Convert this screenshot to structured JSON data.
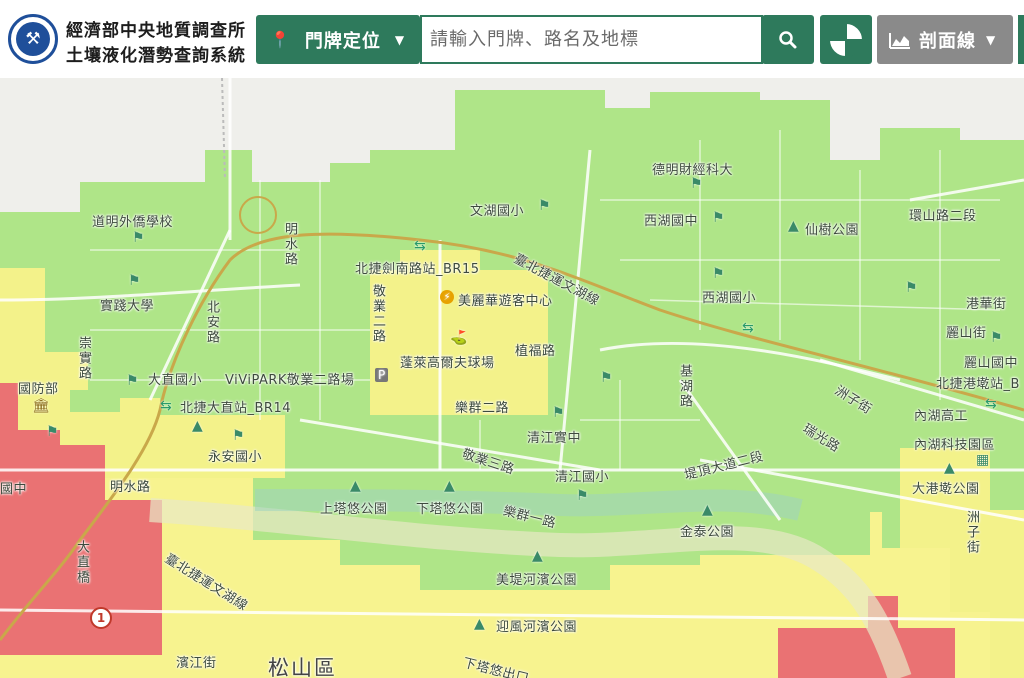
{
  "header": {
    "title_line1": "經濟部中央地質調查所",
    "title_line2": "土壤液化潛勢查詢系統",
    "logo_icon": "agency-seal-icon",
    "locate_label": "門牌定位",
    "search_placeholder": "請輸入門牌、路名及地標",
    "profile_label": "剖面線"
  },
  "colors": {
    "high": "#e96a72",
    "medium": "#f7f28a",
    "low": "#a9e47f",
    "accent": "#2e7a5c"
  },
  "map": {
    "district": "松山區",
    "labels": {
      "daoming": "道明外僑學校",
      "wenhu": "文湖國小",
      "deming": "德明財經科大",
      "xihu_jh": "西湖國中",
      "xianshu": "仙樹公園",
      "huanshan": "環山路二段",
      "shijian": "實踐大學",
      "mingshui_rd_top": "明水路",
      "beijie_jiannan": "北捷劍南路站_BR15",
      "meili": "美麗華遊客中心",
      "wenhu_line": "臺北捷運文湖線",
      "xihu_es": "西湖國小",
      "ganghua": "港華街",
      "beian": "北安路",
      "jingye2": "敬業二路",
      "lilai": "蓬萊高爾夫球場",
      "zhifu": "植福路",
      "lishan": "麗山街",
      "lishan_jh": "麗山國中",
      "beijie_gangshu": "北捷港墘站_B",
      "chongshi": "崇實路",
      "dazhi_es": "大直國小",
      "vivipark": "ViViPARK敬業二路場",
      "jihu": "基湖路",
      "zhouzi": "洲子街",
      "guofang": "國防部",
      "beijie_dazhi": "北捷大直站_BR14",
      "lequn2": "樂群二路",
      "neihu_hs": "內湖高工",
      "qingjiang_ss": "清江實中",
      "ruiguang": "瑞光路",
      "yongan": "永安國小",
      "neihu_tech": "內湖科技園區",
      "jingye3": "敬業三路",
      "dizhong": "國中",
      "mingshui_rd": "明水路",
      "qingjiang_es": "清江國小",
      "dinghu": "堤頂大道二段",
      "dagang": "大港墘公園",
      "shangtayou": "上塔悠公園",
      "xiatayou": "下塔悠公園",
      "lequn1": "樂群一路",
      "jintai": "金泰公園",
      "dazhi_bridge": "大直橋",
      "wenhu_line2": "臺北捷運文湖線",
      "meidi": "美堤河濱公園",
      "yingfeng": "迎風河濱公園",
      "qingjiang_st": "濱江街",
      "xiatayou_rd": "下塔悠出口",
      "road_shield": "1",
      "zhou_st": "洲子街"
    }
  }
}
